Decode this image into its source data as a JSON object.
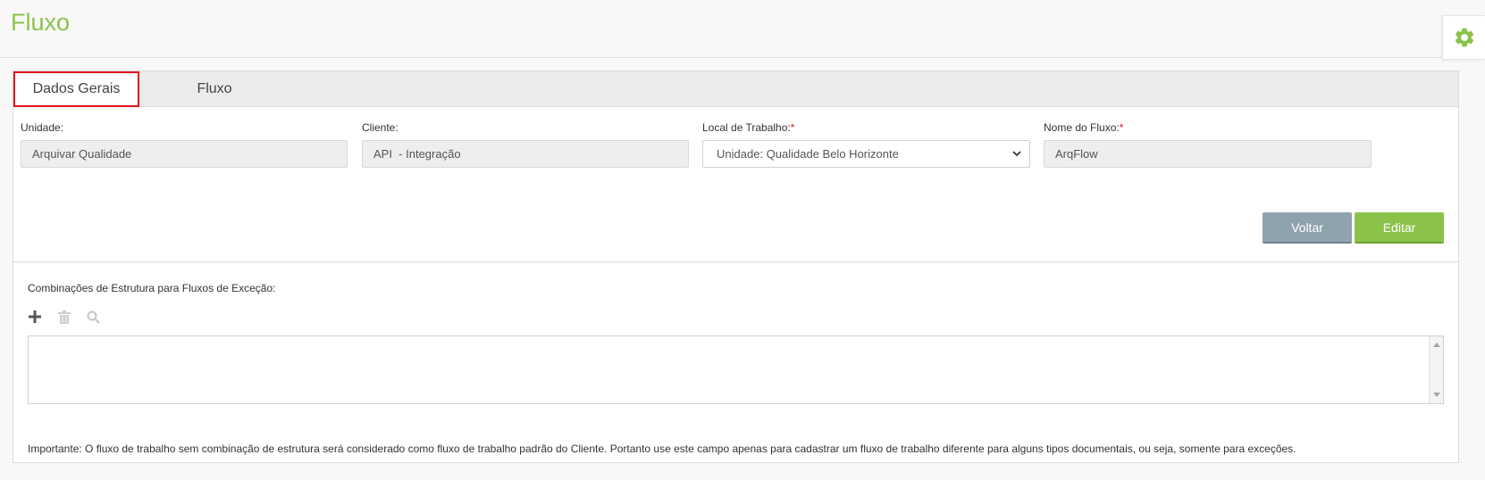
{
  "page": {
    "title": "Fluxo"
  },
  "tabs": [
    {
      "label": "Dados Gerais",
      "active": true
    },
    {
      "label": "Fluxo",
      "active": false
    }
  ],
  "form": {
    "unidade": {
      "label": "Unidade:",
      "value": "Arquivar Qualidade"
    },
    "cliente": {
      "label": "Cliente:",
      "value": "API  - Integração"
    },
    "local": {
      "label": "Local de Trabalho:",
      "required_mark": "*",
      "value": "Unidade: Qualidade Belo Horizonte"
    },
    "nome": {
      "label": "Nome do Fluxo:",
      "required_mark": "*",
      "value": "ArqFlow"
    }
  },
  "buttons": {
    "back": "Voltar",
    "edit": "Editar"
  },
  "exceptions": {
    "label": "Combinações de Estrutura para Fluxos de Exceção:",
    "toolbar": [
      "plus-icon",
      "trash-icon",
      "search-icon"
    ]
  },
  "note": "Importante: O fluxo de trabalho sem combinação de estrutura será considerado como fluxo de trabalho padrão do Cliente. Portanto use este campo apenas para cadastrar um fluxo de trabalho diferente para alguns tipos documentais, ou seja, somente para exceções.",
  "colors": {
    "brand_green": "#8bc34a",
    "gray_button": "#8fa3ad",
    "active_tab_border": "#e0141e"
  }
}
